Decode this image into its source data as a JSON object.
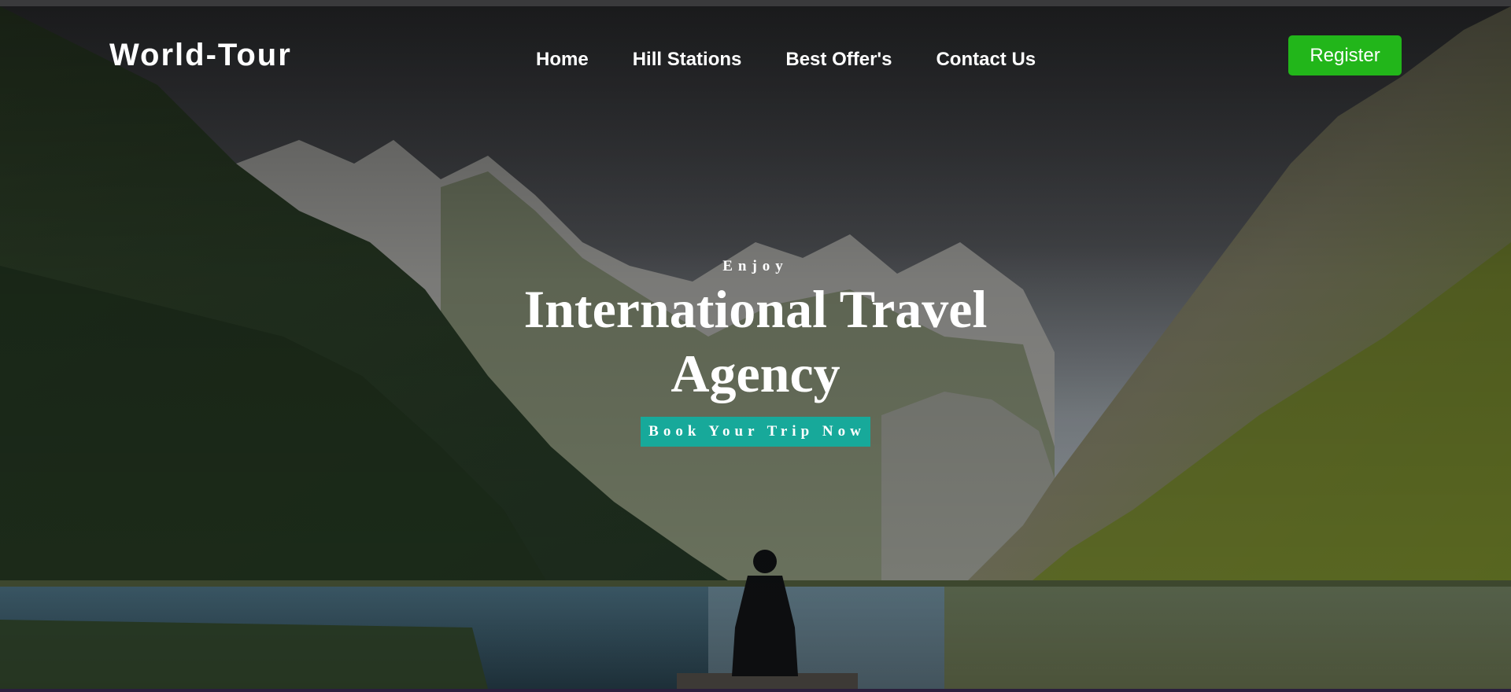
{
  "brand": {
    "name": "World-Tour"
  },
  "nav": {
    "items": [
      {
        "label": "Home"
      },
      {
        "label": "Hill Stations"
      },
      {
        "label": "Best Offer's"
      },
      {
        "label": "Contact Us"
      }
    ],
    "register_label": "Register"
  },
  "hero": {
    "kicker": "Enjoy",
    "headline_line1": "International Travel",
    "headline_line2": "Agency",
    "cta_label": "Book Your Trip Now"
  },
  "colors": {
    "register_bg": "#22b61a",
    "cta_bg": "#17a99a",
    "text": "#ffffff"
  },
  "icons": {
    "background": "mountain-lake-photo"
  }
}
